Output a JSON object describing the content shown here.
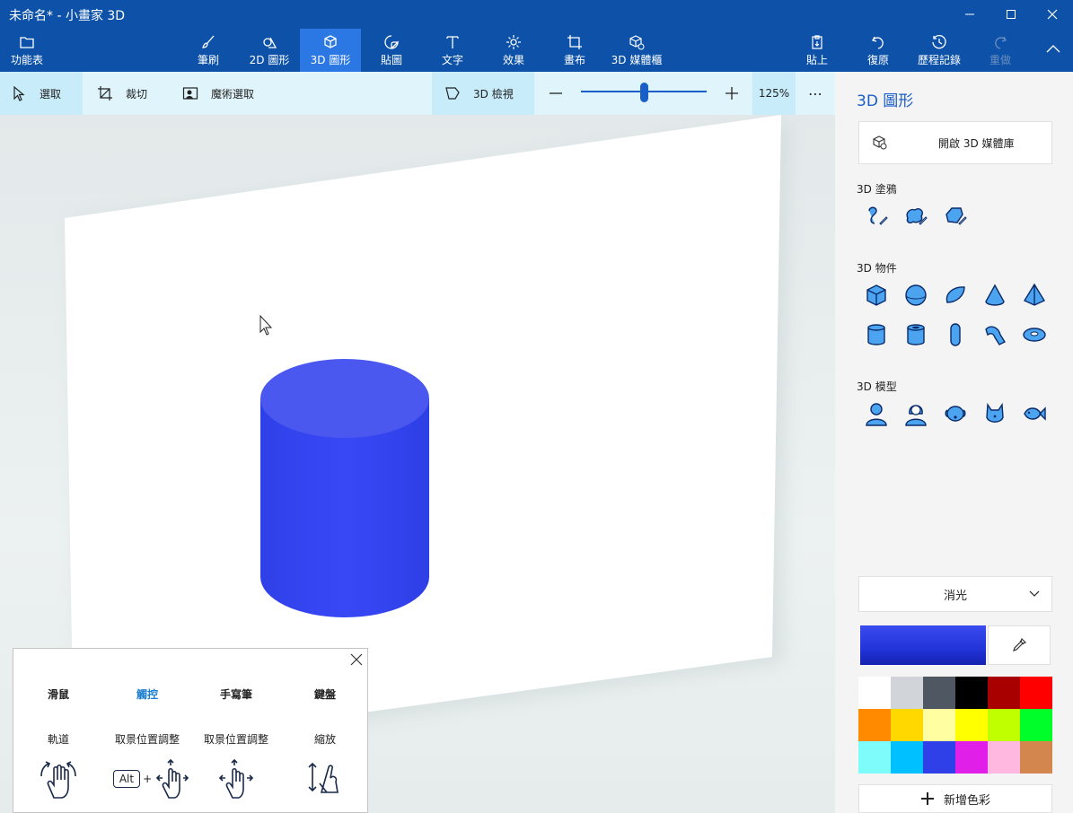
{
  "window": {
    "title": "未命名* - 小畫家 3D",
    "controls": [
      "minimize",
      "maximize",
      "close"
    ]
  },
  "ribbon": {
    "menu": "功能表",
    "tabs": [
      {
        "label": "筆刷",
        "icon": "brush-icon"
      },
      {
        "label": "2D 圖形",
        "icon": "2d-shapes-icon"
      },
      {
        "label": "3D 圖形",
        "icon": "3d-shapes-icon",
        "active": true
      },
      {
        "label": "貼圖",
        "icon": "stickers-icon"
      },
      {
        "label": "文字",
        "icon": "text-icon"
      },
      {
        "label": "效果",
        "icon": "effects-icon"
      },
      {
        "label": "畫布",
        "icon": "canvas-icon"
      },
      {
        "label": "3D 媒體櫃",
        "icon": "3d-library-icon"
      }
    ],
    "right": [
      {
        "label": "貼上",
        "icon": "paste-icon"
      },
      {
        "label": "復原",
        "icon": "undo-icon"
      },
      {
        "label": "歷程記錄",
        "icon": "history-icon"
      },
      {
        "label": "重做",
        "icon": "redo-icon",
        "disabled": true
      }
    ]
  },
  "toolbar": {
    "select": "選取",
    "crop": "裁切",
    "magic_select": "魔術選取",
    "view_3d": "3D 檢視",
    "zoom_percent": "125%",
    "zoom_level": 0.5,
    "more": "⋯"
  },
  "panel": {
    "title": "3D 圖形",
    "library_button": "開啟 3D 媒體庫",
    "doodle_label": "3D 塗鴉",
    "doodles": [
      "sharp-doodle-icon",
      "soft-doodle-icon",
      "tube-doodle-icon"
    ],
    "objects_label": "3D 物件",
    "objects": [
      "cube-icon",
      "sphere-icon",
      "hemisphere-icon",
      "cone-icon",
      "pyramid-icon",
      "cylinder-icon",
      "tube-icon",
      "capsule-icon",
      "curved-tube-icon",
      "donut-icon"
    ],
    "models_label": "3D 模型",
    "models": [
      "man-model-icon",
      "woman-model-icon",
      "dog-model-icon",
      "cat-model-icon",
      "fish-model-icon"
    ],
    "finish": "消光",
    "selected_color": "#2f40e8",
    "palette": [
      "#ffffff",
      "#d1d5da",
      "#4f5862",
      "#000000",
      "#a80000",
      "#ff0000",
      "#ff8a00",
      "#ffd800",
      "#fffea0",
      "#ffff00",
      "#bfff00",
      "#00ff2a",
      "#7efcfc",
      "#00c0ff",
      "#2f40e8",
      "#e020e8",
      "#ffb8e0",
      "#d4864f"
    ],
    "add_color": "新增色彩"
  },
  "help": {
    "tabs": [
      "滑鼠",
      "觸控",
      "手寫筆",
      "鍵盤"
    ],
    "active_tab": 1,
    "actions": [
      "軌道",
      "取景位置調整",
      "取景位置調整",
      "縮放"
    ],
    "key": "Alt",
    "plus": "+"
  }
}
